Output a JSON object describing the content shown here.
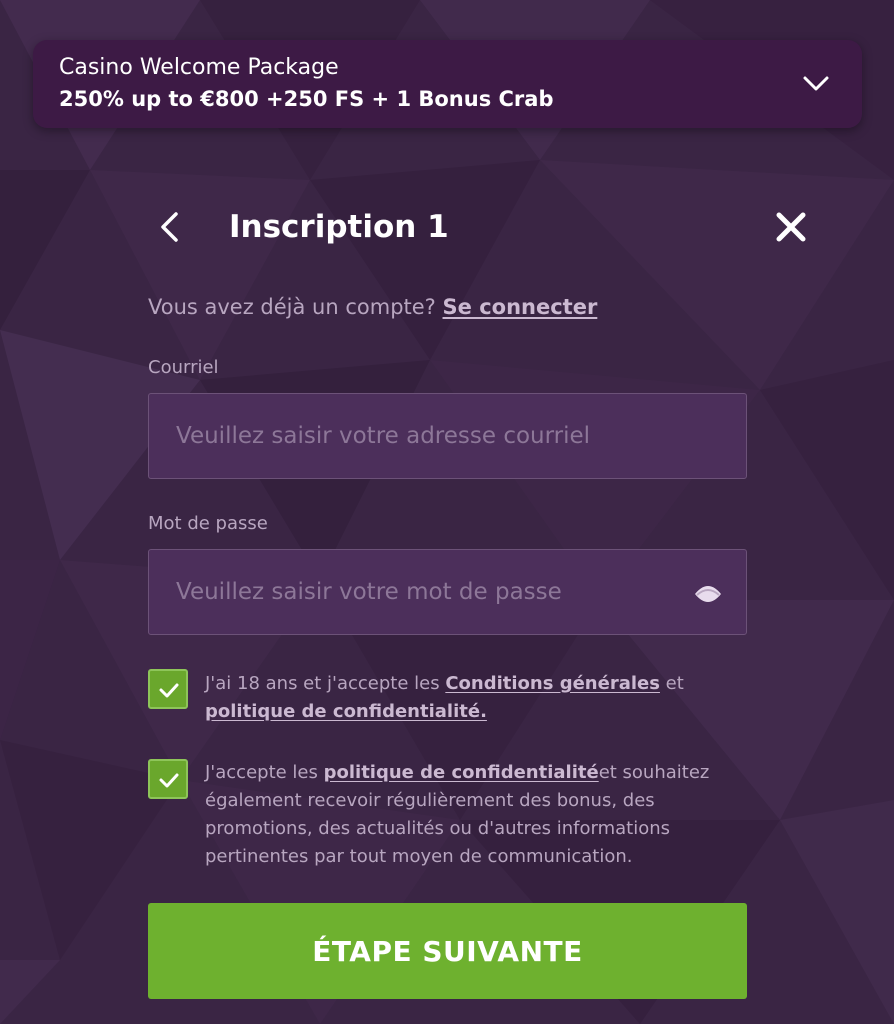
{
  "promo": {
    "title": "Casino Welcome Package",
    "offer": "250% up to €800 +250 FS + 1 Bonus Crab",
    "expand_icon": "chevron-down-icon"
  },
  "header": {
    "back_icon": "chevron-left-icon",
    "title": "Inscription 1",
    "close_icon": "close-icon"
  },
  "login_prompt": {
    "text": "Vous avez déjà un compte?",
    "link": "Se connecter"
  },
  "email": {
    "label": "Courriel",
    "value": "",
    "placeholder": "Veuillez saisir votre adresse courriel"
  },
  "password": {
    "label": "Mot de passe",
    "value": "",
    "placeholder": "Veuillez saisir votre mot de passe",
    "toggle_icon": "eye-icon"
  },
  "consents": [
    {
      "checked": true,
      "text_before": "J'ai 18 ans et j'accepte les ",
      "link1": "Conditions générales",
      "text_middle": " et ",
      "link2": "politique de confidentialité."
    },
    {
      "checked": true,
      "text_before": "J'accepte les ",
      "link1": "politique de confidentialité",
      "text_after": "et souhaitez également recevoir régulièrement des bonus, des promotions, des actualités ou d'autres informations pertinentes par tout moyen de communication."
    }
  ],
  "submit": {
    "label": "ÉTAPE SUIVANTE"
  },
  "colors": {
    "background": "#3a2544",
    "promo_bar": "#3d1a45",
    "input_bg": "#4c2f5b",
    "accent_green": "#6eb12f",
    "muted_text": "#b8a6c0"
  }
}
